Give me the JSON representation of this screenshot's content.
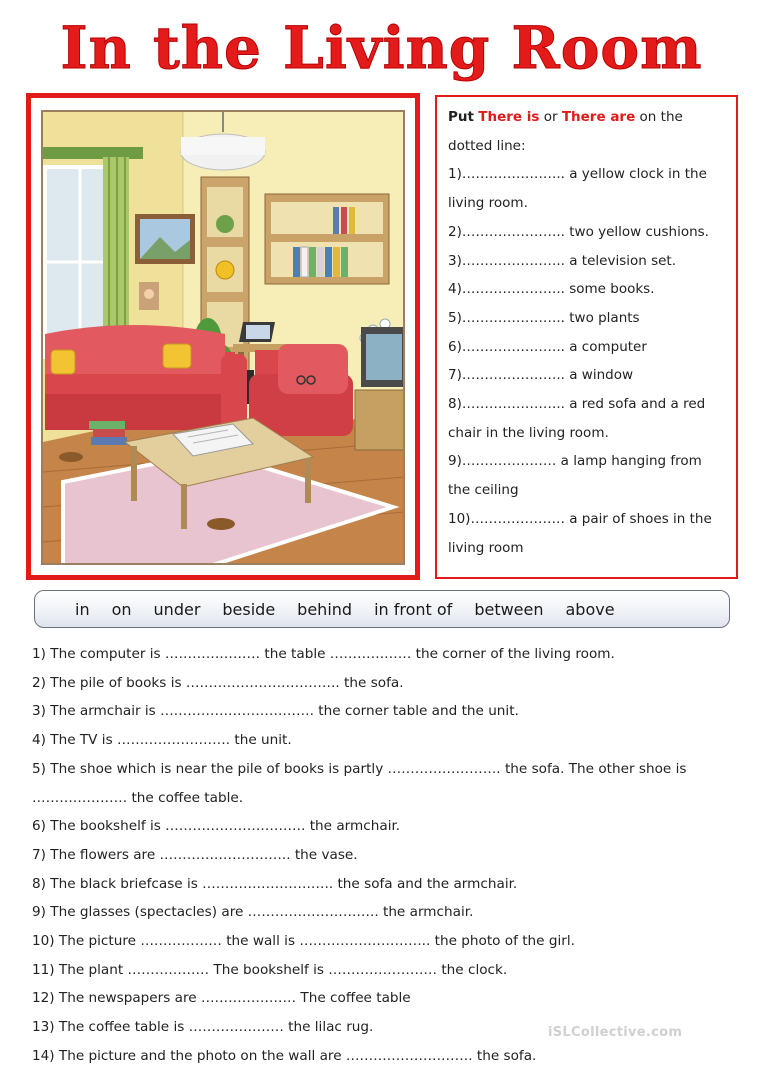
{
  "title": "In the Living Room",
  "exercise1": {
    "instruction_put": "Put",
    "there_is": "There is",
    "or": "or",
    "there_are": "There are",
    "instruction_rest": "on the",
    "instruction_line2": "dotted line:",
    "lines": [
      "1)………………….. a yellow clock in the",
      "living room.",
      "2)………………….. two yellow cushions.",
      "3)………………….. a television set.",
      "4)………………….. some books.",
      "5)………………….. two plants",
      "6)………………….. a computer",
      "7)………………….. a window",
      "8)………………….. a red sofa and a red",
      "chair in the living room.",
      "9)………………… a lamp hanging from",
      "the ceiling",
      "10)………………… a pair of shoes in the",
      "living room"
    ]
  },
  "prepositions": [
    "in",
    "on",
    "under",
    "beside",
    "behind",
    "in front of",
    "between",
    "above"
  ],
  "sentences": [
    "1) The computer is ………………… the table ……………… the corner of the living room.",
    "2) The pile of books is ……………………………. the sofa.",
    "3) The armchair is ……………………………. the corner table and the unit.",
    "4) The TV is ……………………. the unit.",
    "5) The shoe which is near the pile of books is partly ……………………. the sofa. The other shoe is",
    "………………… the coffee table.",
    "6) The bookshelf is …………………………. the armchair.",
    "7) The flowers are ……………………….. the vase.",
    "8) The black briefcase is ……………………….. the sofa and the armchair.",
    "9)  The glasses (spectacles) are ……………………….. the armchair.",
    "10) The picture ……………… the wall is ……………………….. the photo of the girl.",
    "11) The plant ……………… The bookshelf is …………………… the clock.",
    "12) The newspapers are ………………… The coffee table",
    "13) The coffee table is ………………… the lilac rug.",
    "14) The picture and the photo on the wall are ………………………. the sofa."
  ],
  "watermark": "iSLCollective.com",
  "colors": {
    "accent_red": "#e11a1a",
    "sofa_red": "#d9474d",
    "wall_yellow": "#f6eaa8"
  }
}
